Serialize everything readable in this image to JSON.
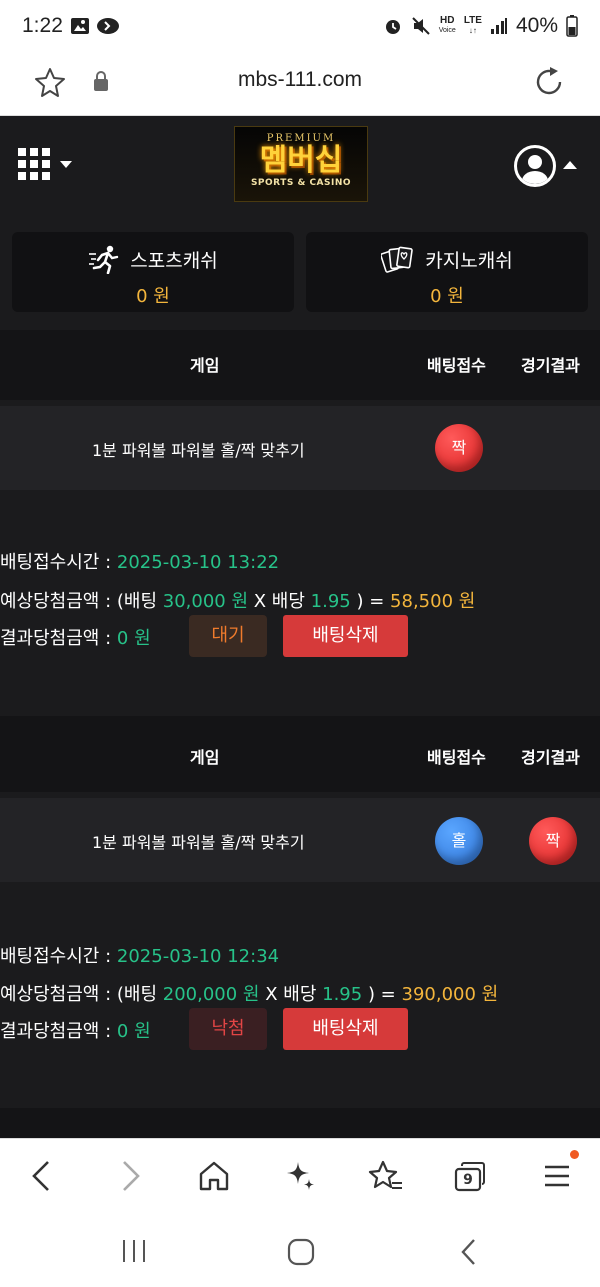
{
  "status_bar": {
    "time": "1:22",
    "network": "HD",
    "network_sub": "Voice",
    "lte": "LTE",
    "battery": "40%"
  },
  "address_bar": {
    "url": "mbs-111.com"
  },
  "header": {
    "logo": {
      "top": "PREMIUM",
      "main": "멤버십",
      "sub": "SPORTS & CASINO"
    }
  },
  "balances": [
    {
      "label": "스포츠캐쉬",
      "amount": "0 원",
      "icon": "running-person-icon"
    },
    {
      "label": "카지노캐쉬",
      "amount": "0 원",
      "icon": "playing-cards-icon"
    }
  ],
  "columns": {
    "game": "게임",
    "bet": "배팅접수",
    "result": "경기결과"
  },
  "bets": [
    {
      "game": "1분 파워볼 파워볼 홀/짝 맞추기",
      "bet_pick": "짝",
      "bet_pick_color": "#e02626",
      "result": "",
      "time_label": "배팅접수시간 :",
      "time_value": "2025-03-10 13:22",
      "expected_label": "예상당첨금액 : (배팅",
      "bet_amount": "30,000 원",
      "x_label": "X 배당",
      "odds": "1.95",
      "eq": ") =",
      "expected_amount": "58,500 원",
      "result_label": "결과당첨금액 :",
      "result_amount": "0 원",
      "status": "대기",
      "delete_label": "배팅삭제"
    },
    {
      "game": "1분 파워볼 파워볼 홀/짝 맞추기",
      "bet_pick": "홀",
      "bet_pick_color": "#2f74d6",
      "result": "짝",
      "result_color": "#e02626",
      "time_label": "배팅접수시간 :",
      "time_value": "2025-03-10 12:34",
      "expected_label": "예상당첨금액 : (배팅",
      "bet_amount": "200,000 원",
      "x_label": "X 배당",
      "odds": "1.95",
      "eq": ") =",
      "expected_amount": "390,000 원",
      "result_label": "결과당첨금액 :",
      "result_amount": "0 원",
      "status": "낙첨",
      "delete_label": "배팅삭제"
    }
  ],
  "toolbar": {
    "tab_count": "9"
  },
  "colors": {
    "accent_green": "#27c289",
    "accent_yellow": "#f3b53c",
    "danger": "#d63a3a"
  }
}
